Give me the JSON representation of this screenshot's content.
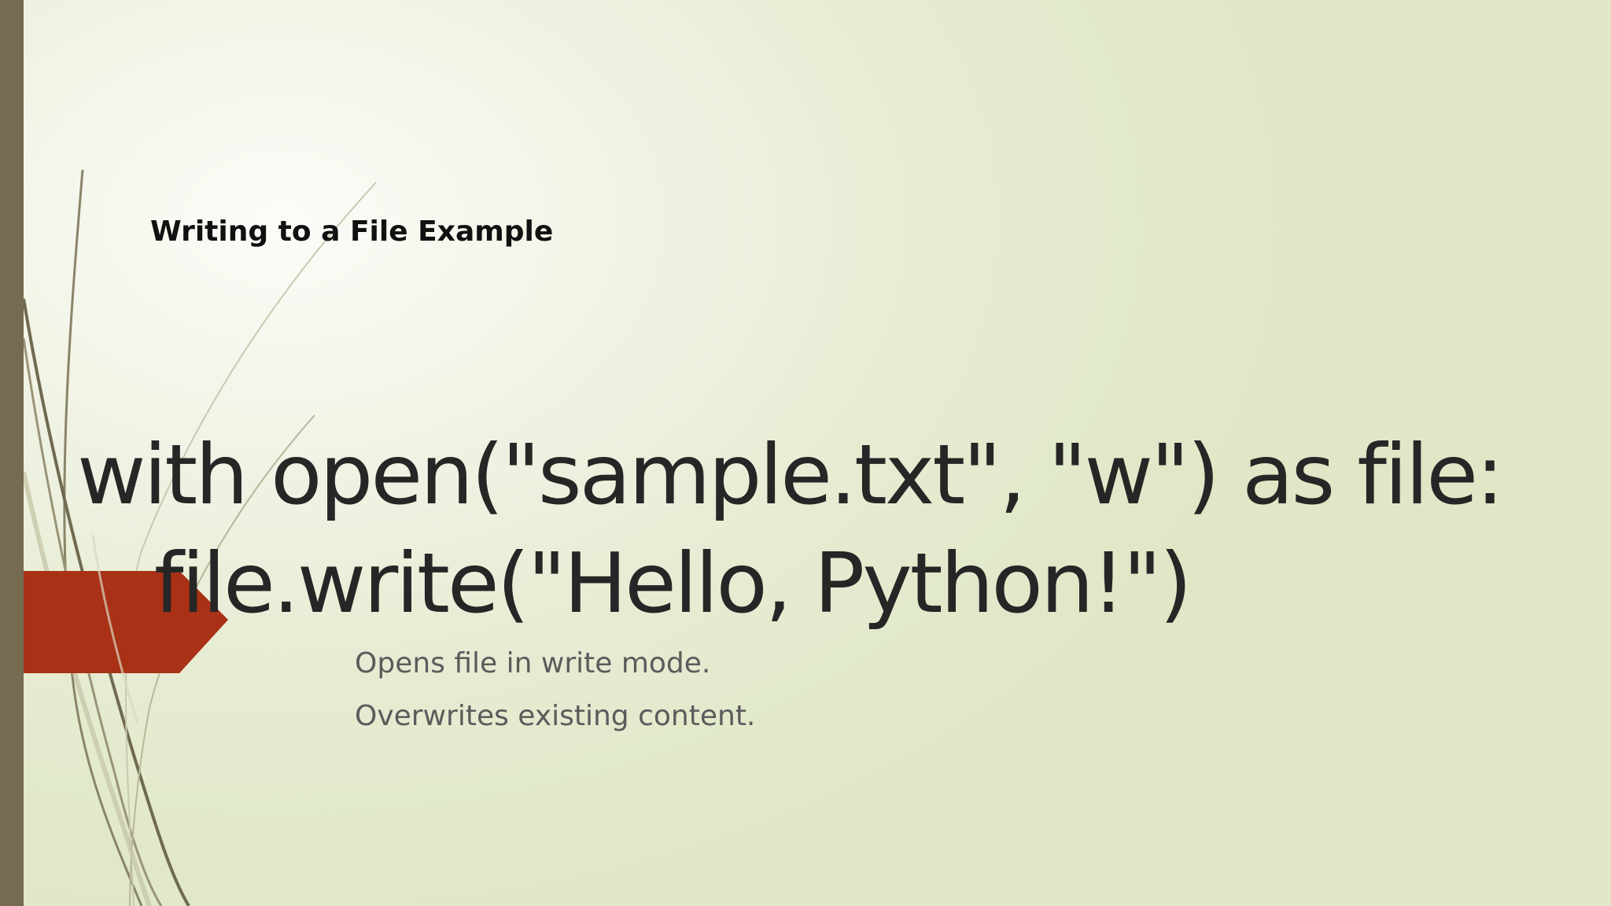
{
  "slide": {
    "title": "Writing to a File Example",
    "code_lines": [
      "with open(\"sample.txt\", \"w\") as file:",
      "file.write(\"Hello, Python!\")"
    ],
    "bullets": [
      "Opens file in write mode.",
      "Overwrites existing content."
    ]
  },
  "colors": {
    "left_bar": "#746b51",
    "accent_arrow": "#a93115",
    "background_light": "#fbfcf8",
    "background_dark": "#dfe7c6"
  }
}
